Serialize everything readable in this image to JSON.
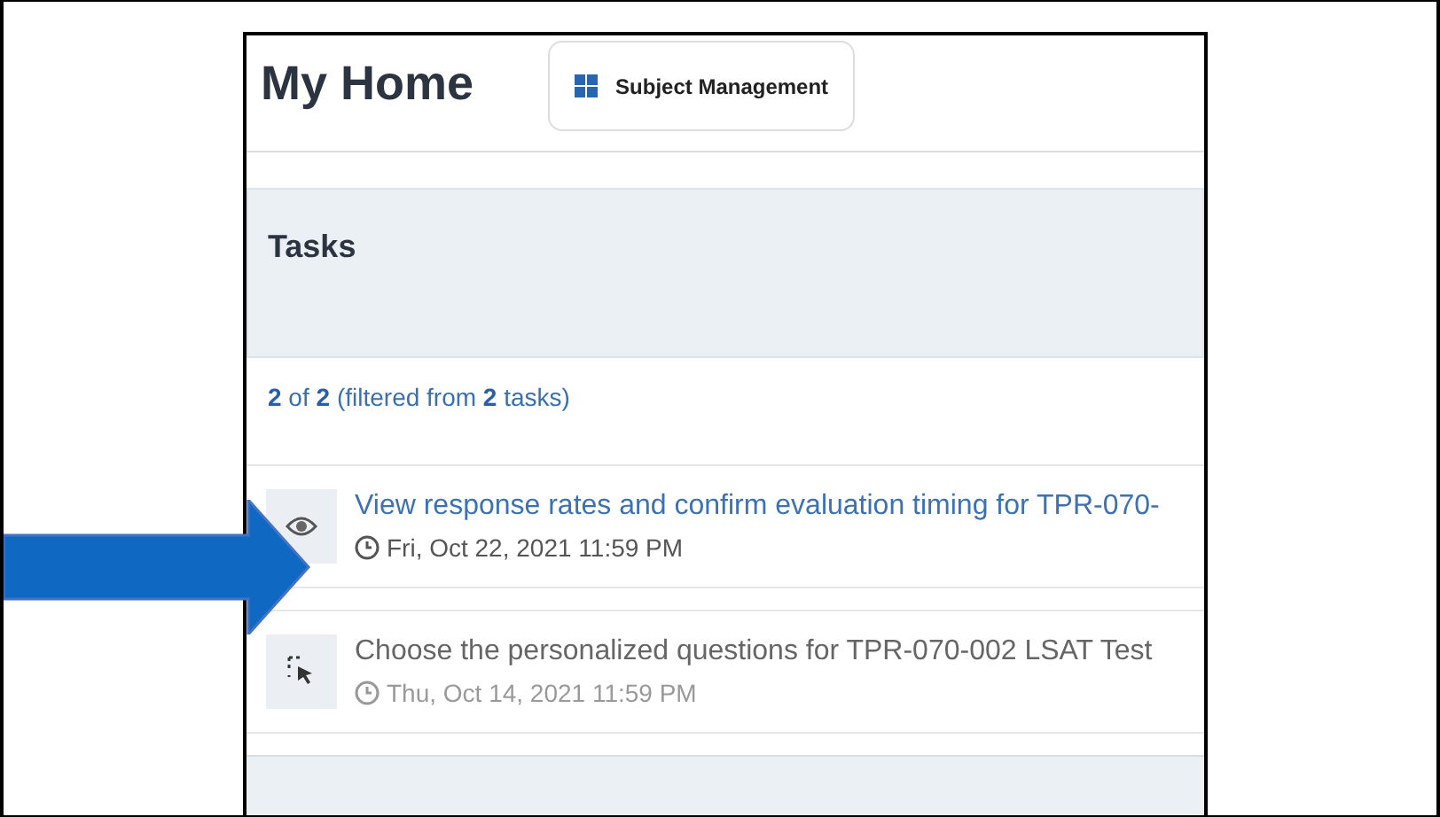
{
  "header": {
    "title": "My Home",
    "button": "Subject Management"
  },
  "tasks_panel": {
    "title": "Tasks",
    "summary": "**2** of **2** (filtered from **2** tasks)",
    "items": [
      {
        "kind": "view",
        "title": "View response rates and confirm evaluation timing for TPR-070-",
        "due": "Fri, Oct 22, 2021 11:59 PM"
      },
      {
        "kind": "choose",
        "title": "Choose the personalized questions for TPR-070-002 LSAT Test",
        "due": "Thu, Oct 14, 2021 11:59 PM"
      }
    ]
  }
}
